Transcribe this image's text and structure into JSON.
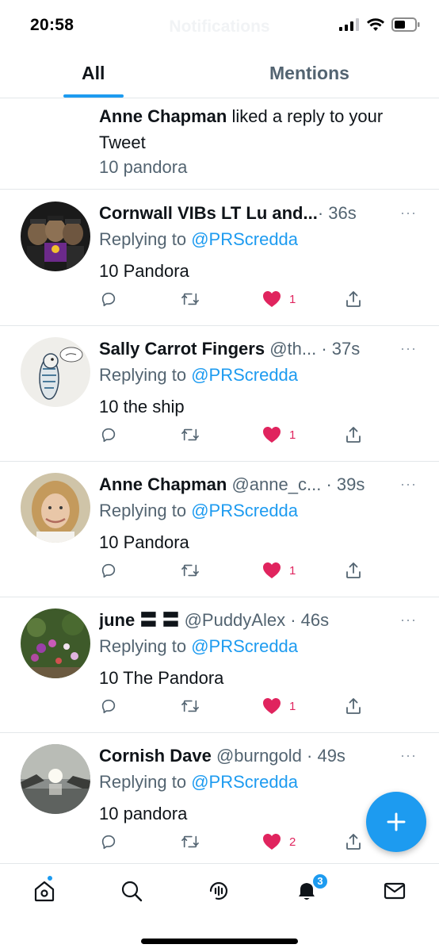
{
  "status_bar": {
    "time": "20:58",
    "ghost_title": "Notifications"
  },
  "tabs": [
    {
      "label": "All",
      "active": true
    },
    {
      "label": "Mentions",
      "active": false
    }
  ],
  "like_notification": {
    "actor": "Anne Chapman",
    "action": " liked a reply to your Tweet",
    "snippet": "10 pandora"
  },
  "replies": [
    {
      "author": "Cornwall VIBs LT Lu and...",
      "handle": "",
      "time": "· 36s",
      "replying_prefix": "Replying to ",
      "replying_to": "@PRScredda",
      "text": "10 Pandora",
      "like_count": "1",
      "avatar_icon": "cornwall-vibs-avatar"
    },
    {
      "author": "Sally Carrot Fingers",
      "handle": " @th...",
      "time": " · 37s",
      "replying_prefix": "Replying to ",
      "replying_to": "@PRScredda",
      "text": "10 the ship",
      "like_count": "1",
      "avatar_icon": "budgie-drawing-avatar"
    },
    {
      "author": "Anne Chapman",
      "handle": " @anne_c...",
      "time": " · 39s",
      "replying_prefix": "Replying to ",
      "replying_to": "@PRScredda",
      "text": "10 Pandora",
      "like_count": "1",
      "avatar_icon": "woman-portrait-avatar"
    },
    {
      "author": "june",
      "flag": " 〓 〓",
      "handle": " @PuddyAlex",
      "time": " · 46s",
      "replying_prefix": "Replying to ",
      "replying_to": "@PRScredda",
      "text": "10 The Pandora",
      "like_count": "1",
      "avatar_icon": "flowers-avatar"
    },
    {
      "author": "Cornish Dave",
      "handle": " @burngold",
      "time": " · 49s",
      "replying_prefix": "Replying to ",
      "replying_to": "@PRScredda",
      "text": "10 pandora",
      "like_count": "2",
      "avatar_icon": "sunset-avatar"
    }
  ],
  "more_glyph": "···",
  "fab": {
    "icon": "plus-icon"
  },
  "bottom_nav": {
    "items": [
      "home-icon",
      "search-icon",
      "spaces-icon",
      "bell-icon",
      "mail-icon"
    ],
    "notification_badge": "3"
  },
  "colors": {
    "accent": "#1d9bf0",
    "like": "#e0245e",
    "secondary_text": "#536471"
  }
}
